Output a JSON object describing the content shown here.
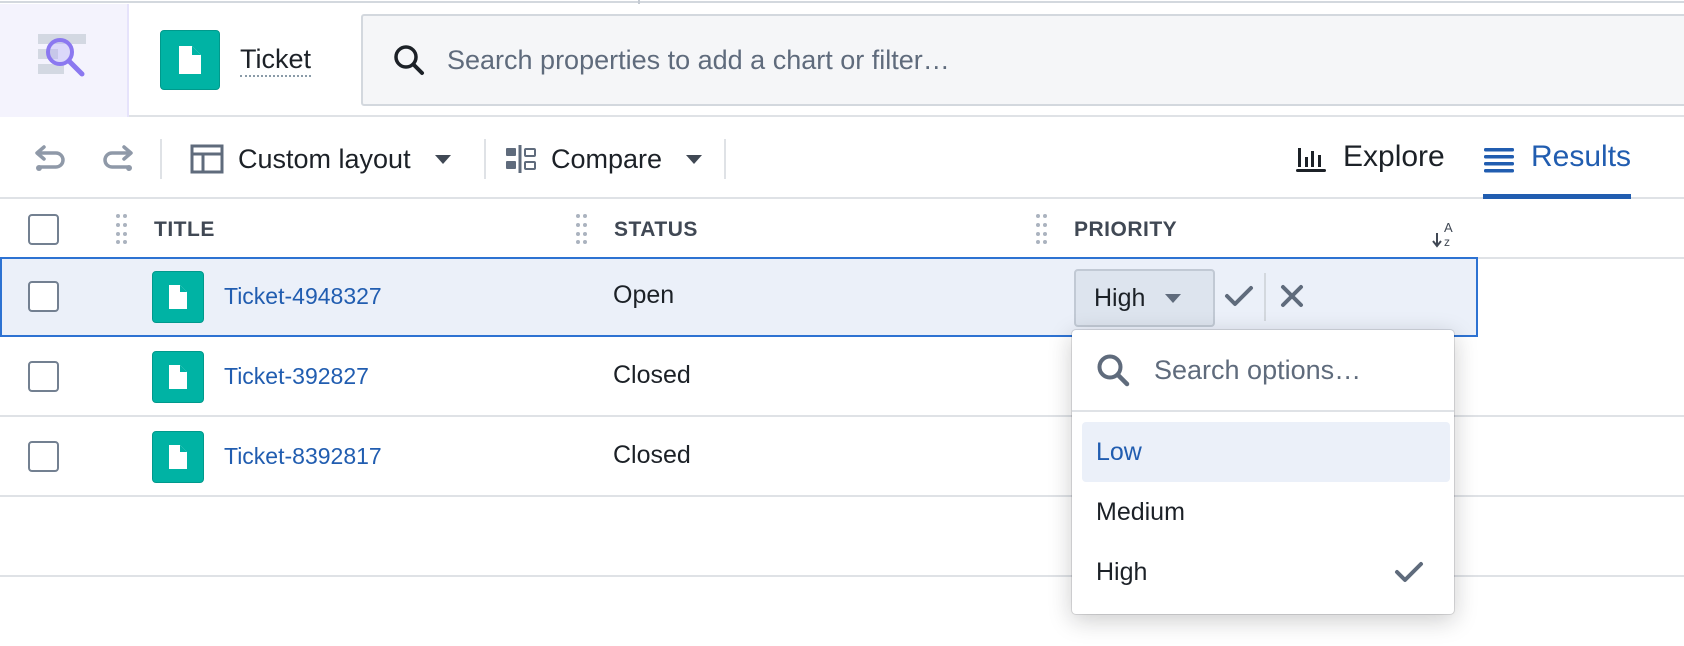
{
  "header": {
    "object_type_label": "Ticket",
    "search_placeholder": "Search properties to add a chart or filter…"
  },
  "toolbar": {
    "layout_label": "Custom layout",
    "compare_label": "Compare",
    "tabs": [
      {
        "label": "Explore",
        "icon": "bar-chart-icon",
        "active": false
      },
      {
        "label": "Results",
        "icon": "list-icon",
        "active": true
      }
    ]
  },
  "table": {
    "columns": [
      {
        "label": "TITLE"
      },
      {
        "label": "STATUS"
      },
      {
        "label": "PRIORITY",
        "sort": "alphabetical"
      }
    ],
    "rows": [
      {
        "title": "Ticket-4948327",
        "status": "Open",
        "priority": "High",
        "editing": true,
        "selected": false
      },
      {
        "title": "Ticket-392827",
        "status": "Closed",
        "selected": false
      },
      {
        "title": "Ticket-8392817",
        "status": "Closed",
        "selected": false
      }
    ]
  },
  "priority_dropdown": {
    "search_placeholder": "Search options…",
    "options": [
      {
        "label": "Low",
        "highlighted": true,
        "checked": false
      },
      {
        "label": "Medium",
        "highlighted": false,
        "checked": false
      },
      {
        "label": "High",
        "highlighted": false,
        "checked": true
      }
    ]
  },
  "colors": {
    "accent": "#215db0",
    "object_icon": "#00b3a4",
    "selected_row_bg": "#ebf0f9",
    "selected_row_border": "#2d72d2"
  }
}
